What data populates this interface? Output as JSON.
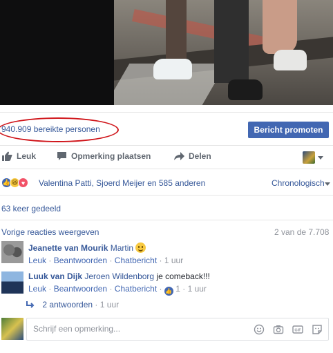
{
  "post": {
    "reach_text": "940.909 bereikte personen",
    "promote_label": "Bericht promoten"
  },
  "actions": {
    "like": "Leuk",
    "comment": "Opmerking plaatsen",
    "share": "Delen"
  },
  "reactions": {
    "summary": "Valentina Patti, Sjoerd Meijer en 585 anderen",
    "sort_label": "Chronologisch"
  },
  "shares_text": "63 keer gedeeld",
  "comments": {
    "prev_label": "Vorige reacties weergeven",
    "count": "2 van de 7.708",
    "items": [
      {
        "author": "Jeanette van Mourik",
        "tag": "Martin",
        "text": "",
        "like": "Leuk",
        "reply": "Beantwoorden",
        "chat": "Chatbericht",
        "time": "1 uur"
      },
      {
        "author": "Luuk van Dijk",
        "tag": "Jeroen Wildenborg",
        "text": "je comeback!!!",
        "like": "Leuk",
        "reply": "Beantwoorden",
        "chat": "Chatbericht",
        "likes": "1",
        "time": "1 uur"
      }
    ],
    "replies_label": "2 antwoorden",
    "replies_time": "1 uur"
  },
  "composer": {
    "placeholder": "Schrijf een opmerking..."
  },
  "separator": "·",
  "colors": {
    "link": "#365899",
    "button": "#4267b2",
    "highlight_oval": "#d0161b",
    "muted": "#90949c"
  }
}
